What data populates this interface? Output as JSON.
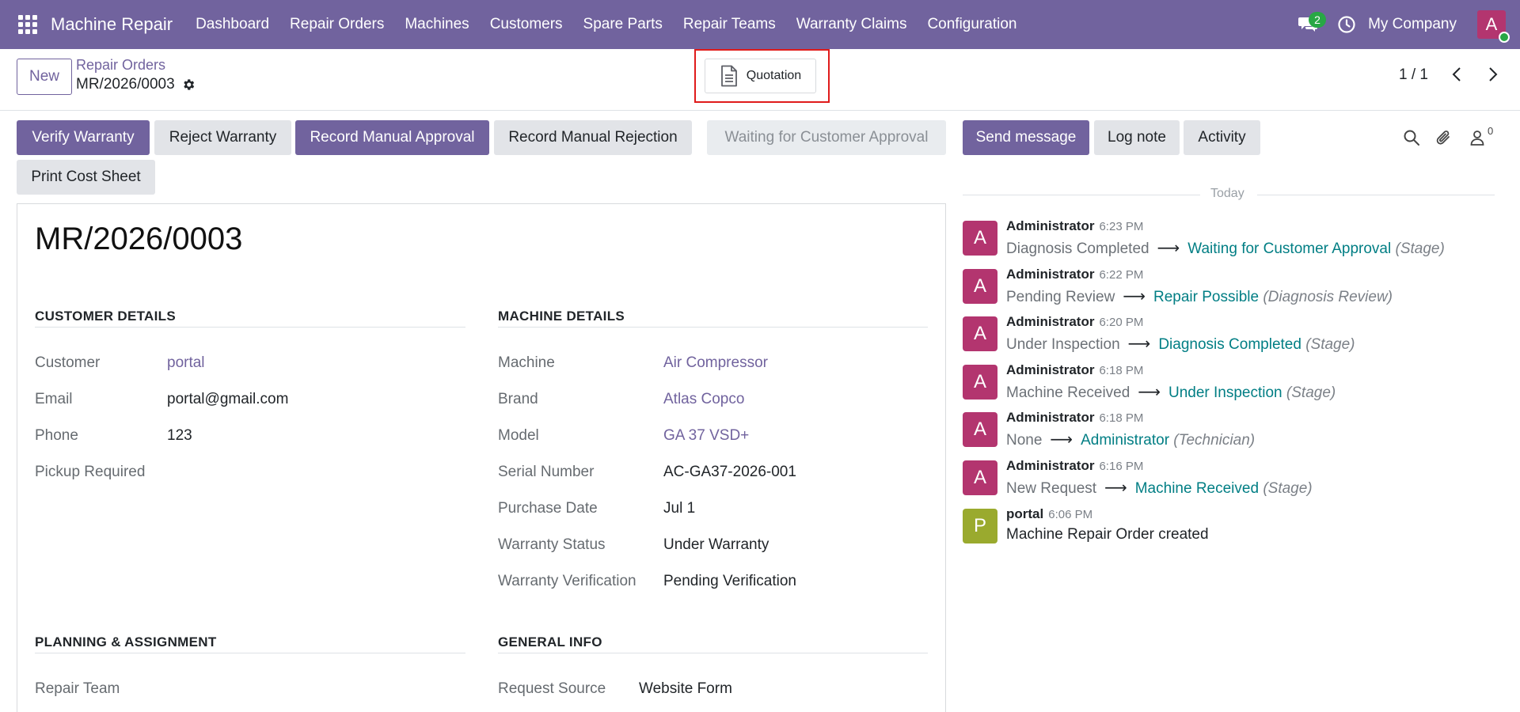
{
  "navbar": {
    "app_name": "Machine Repair",
    "menu": [
      "Dashboard",
      "Repair Orders",
      "Machines",
      "Customers",
      "Spare Parts",
      "Repair Teams",
      "Warranty Claims",
      "Configuration"
    ],
    "messages_count": "2",
    "company": "My Company",
    "user_initial": "A",
    "accent_color": "#71639e"
  },
  "control_panel": {
    "new_label": "New",
    "breadcrumb_parent": "Repair Orders",
    "breadcrumb_current": "MR/2026/0003",
    "quotation_label": "Quotation",
    "pager": "1 / 1"
  },
  "actions": {
    "verify_warranty": "Verify Warranty",
    "reject_warranty": "Reject Warranty",
    "record_manual_approval": "Record Manual Approval",
    "record_manual_rejection": "Record Manual Rejection",
    "print_cost_sheet": "Print Cost Sheet",
    "status": "Waiting for Customer Approval"
  },
  "chatter_actions": {
    "send_message": "Send message",
    "log_note": "Log note",
    "activity": "Activity",
    "followers_count": "0"
  },
  "form": {
    "title": "MR/2026/0003",
    "customer_section": {
      "title": "CUSTOMER DETAILS",
      "customer_label": "Customer",
      "customer_value": "portal",
      "email_label": "Email",
      "email_value": "portal@gmail.com",
      "phone_label": "Phone",
      "phone_value": "123",
      "pickup_label": "Pickup Required"
    },
    "machine_section": {
      "title": "MACHINE DETAILS",
      "machine_label": "Machine",
      "machine_value": "Air Compressor",
      "brand_label": "Brand",
      "brand_value": "Atlas Copco",
      "model_label": "Model",
      "model_value": "GA 37 VSD+",
      "serial_label": "Serial Number",
      "serial_value": "AC-GA37-2026-001",
      "purchase_label": "Purchase Date",
      "purchase_value": "Jul 1",
      "warranty_status_label": "Warranty Status",
      "warranty_status_value": "Under Warranty",
      "warranty_verif_label": "Warranty Verification",
      "warranty_verif_value": "Pending Verification"
    },
    "planning_section": {
      "title": "PLANNING & ASSIGNMENT",
      "repair_team_label": "Repair Team"
    },
    "general_section": {
      "title": "GENERAL INFO",
      "request_source_label": "Request Source",
      "request_source_value": "Website Form"
    }
  },
  "chatter": {
    "today_label": "Today",
    "messages": [
      {
        "initial": "A",
        "author": "Administrator",
        "time": "6:23 PM",
        "old": "Diagnosis Completed",
        "new": "Waiting for Customer Approval",
        "field": "(Stage)",
        "color": "#b3356f"
      },
      {
        "initial": "A",
        "author": "Administrator",
        "time": "6:22 PM",
        "old": "Pending Review",
        "new": "Repair Possible",
        "field": "(Diagnosis Review)",
        "color": "#b3356f"
      },
      {
        "initial": "A",
        "author": "Administrator",
        "time": "6:20 PM",
        "old": "Under Inspection",
        "new": "Diagnosis Completed",
        "field": "(Stage)",
        "color": "#b3356f"
      },
      {
        "initial": "A",
        "author": "Administrator",
        "time": "6:18 PM",
        "old": "Machine Received",
        "new": "Under Inspection",
        "field": "(Stage)",
        "color": "#b3356f"
      },
      {
        "initial": "A",
        "author": "Administrator",
        "time": "6:18 PM",
        "old": "None",
        "new": "Administrator",
        "field": "(Technician)",
        "color": "#b3356f"
      },
      {
        "initial": "A",
        "author": "Administrator",
        "time": "6:16 PM",
        "old": "New Request",
        "new": "Machine Received",
        "field": "(Stage)",
        "color": "#b3356f"
      },
      {
        "initial": "P",
        "author": "portal",
        "time": "6:06 PM",
        "text": "Machine Repair Order created",
        "color": "#9aaa2e"
      }
    ]
  }
}
